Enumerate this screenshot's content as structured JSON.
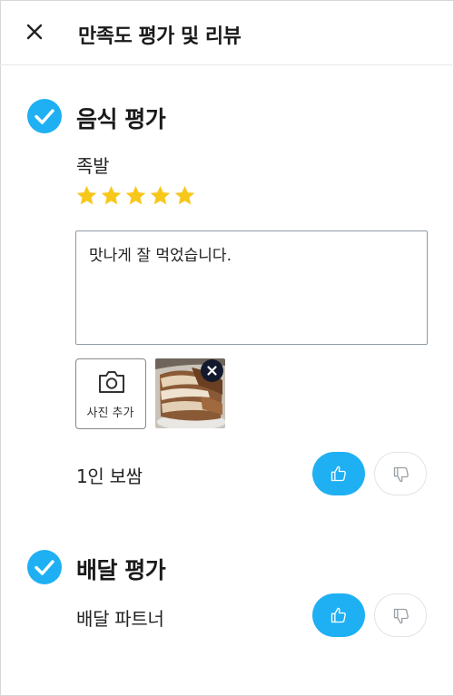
{
  "header": {
    "title": "만족도 평가 및 리뷰",
    "close_icon": "close-icon"
  },
  "food_section": {
    "title": "음식 평가",
    "checked": true,
    "item_name": "족발",
    "rating": 5,
    "rating_max": 5,
    "review_text": "맛나게 잘 먹었습니다.",
    "add_photo_label": "사진 추가",
    "photos_count": 1,
    "option": {
      "label": "1인 보쌈",
      "selected": "thumbs-up"
    }
  },
  "delivery_section": {
    "title": "배달 평가",
    "checked": true,
    "option": {
      "label": "배달 파트너",
      "selected": "thumbs-up"
    }
  },
  "colors": {
    "accent": "#1fb0f3",
    "star": "#f7c81b",
    "remove_badge": "#141a2e"
  }
}
